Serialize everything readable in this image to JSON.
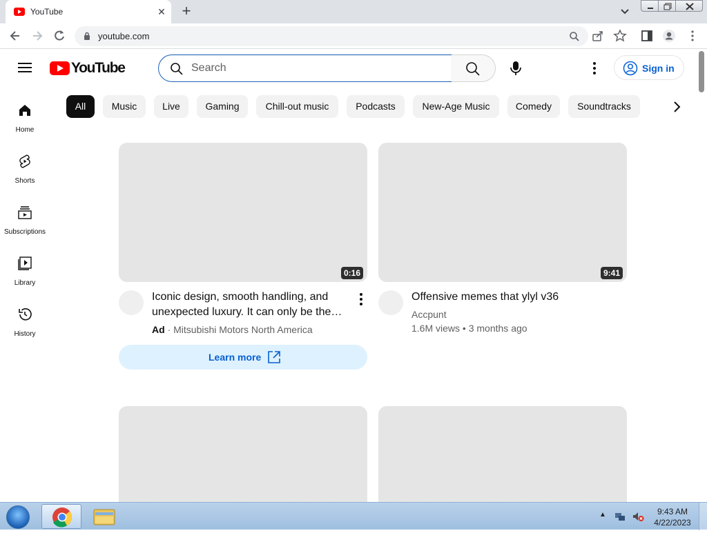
{
  "browser": {
    "tab_title": "YouTube",
    "url": "youtube.com"
  },
  "masthead": {
    "logo_text": "YouTube",
    "search_placeholder": "Search",
    "sign_in_label": "Sign in"
  },
  "chips": [
    "All",
    "Music",
    "Live",
    "Gaming",
    "Chill-out music",
    "Podcasts",
    "New-Age Music",
    "Comedy",
    "Soundtracks"
  ],
  "guide": [
    {
      "label": "Home",
      "icon": "home-icon"
    },
    {
      "label": "Shorts",
      "icon": "shorts-icon"
    },
    {
      "label": "Subscriptions",
      "icon": "subscriptions-icon"
    },
    {
      "label": "Library",
      "icon": "library-icon"
    },
    {
      "label": "History",
      "icon": "history-icon"
    }
  ],
  "videos": [
    {
      "duration": "0:16",
      "title": "Iconic design, smooth handling, and unexpected luxury. It can only be the…",
      "ad_badge": "Ad",
      "channel": "Mitsubishi Motors North America",
      "cta": "Learn more"
    },
    {
      "duration": "9:41",
      "title": "Offensive memes that ylyl v36",
      "channel": "Accpunt",
      "views": "1.6M views",
      "age": "3 months ago"
    }
  ],
  "taskbar": {
    "time": "9:43 AM",
    "date": "4/22/2023"
  },
  "colors": {
    "brand_red": "#ff0000",
    "link_blue": "#065fd4",
    "chip_bg": "#f2f2f2",
    "chip_active_bg": "#0f0f0f",
    "thumb_placeholder": "#e5e5e5"
  }
}
